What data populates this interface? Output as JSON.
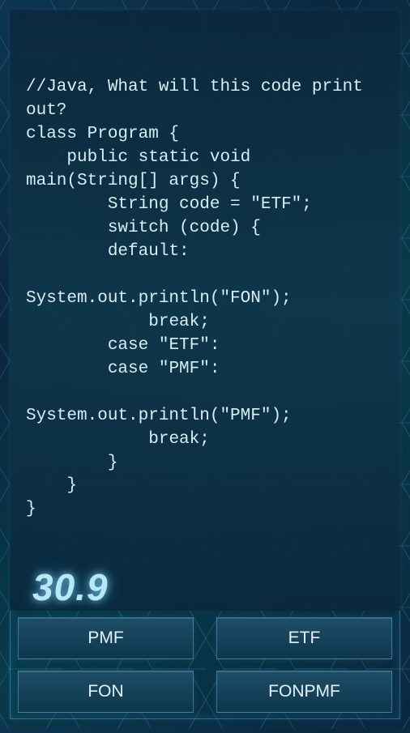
{
  "question": {
    "code": "//Java, What will this code print out?\nclass Program {\n    public static void main(String[] args) {\n        String code = \"ETF\";\n        switch (code) {\n        default:\n\nSystem.out.println(\"FON\");\n            break;\n        case \"ETF\":\n        case \"PMF\":\n\nSystem.out.println(\"PMF\");\n            break;\n        }\n    }\n}"
  },
  "timer": "30.9",
  "answers": [
    {
      "label": "PMF"
    },
    {
      "label": "ETF"
    },
    {
      "label": "FON"
    },
    {
      "label": "FONPMF"
    }
  ],
  "colors": {
    "accent": "#b8e8f5",
    "panel": "#0e364c"
  }
}
